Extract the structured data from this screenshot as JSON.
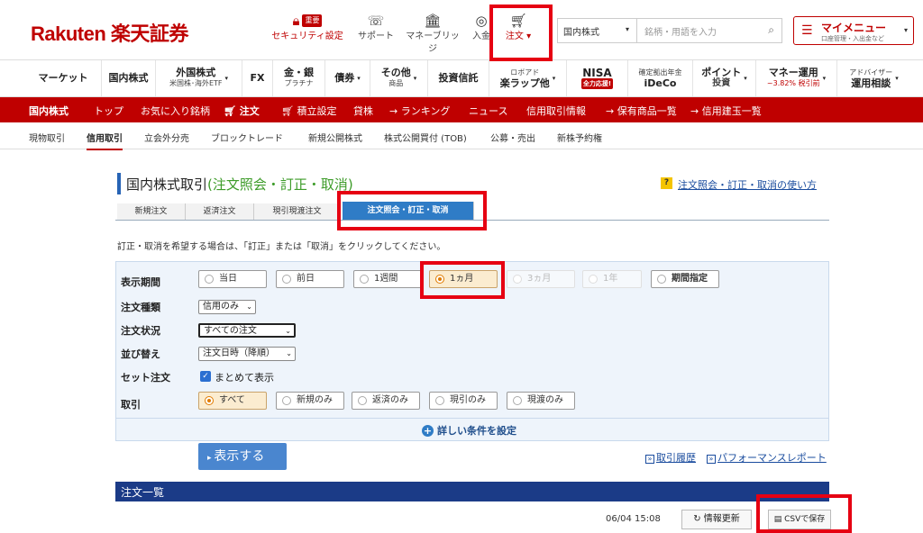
{
  "header": {
    "logo": "Rakuten 楽天証券",
    "security": {
      "label": "セキュリティ設定",
      "badge": "重要"
    },
    "support": "サポート",
    "bridge": "マネーブリッジ",
    "deposit": "入金",
    "order": "注文 ▾",
    "market_select": "国内株式",
    "search_placeholder": "銘柄・用語を入力",
    "mymenu_title": "マイメニュー",
    "mymenu_sub": "口座管理・入出金など"
  },
  "nav2": [
    {
      "label": "マーケット"
    },
    {
      "label": "国内株式"
    },
    {
      "label": "外国株式",
      "sub": "米国株･海外ETF"
    },
    {
      "label": "FX"
    },
    {
      "label": "金・銀",
      "sub": "プラチナ"
    },
    {
      "label": "債券"
    },
    {
      "label": "その他",
      "sub": "商品"
    },
    {
      "label": "投資信託"
    },
    {
      "label": "ロボアド",
      "sub": "楽ラップ他"
    },
    {
      "label": "NISA",
      "sub": "全力応援!"
    },
    {
      "label": "確定拠出年金",
      "sub": "iDeCo"
    },
    {
      "label": "ポイント",
      "sub": "投資"
    },
    {
      "label": "マネー運用",
      "sub": "~3.82% 税引前"
    },
    {
      "label": "アドバイザー",
      "sub": "運用相談"
    }
  ],
  "redbar": [
    "国内株式",
    "トップ",
    "お気に入り銘柄",
    "注文",
    "積立設定",
    "貸株",
    "→ ランキング",
    "ニュース",
    "信用取引情報",
    "→ 保有商品一覧",
    "→ 信用建玉一覧"
  ],
  "subtabs": [
    "現物取引",
    "信用取引",
    "立会外分売",
    "ブロックトレード",
    "新規公開株式",
    "株式公開買付 (TOB)",
    "公募・売出",
    "新株予約権"
  ],
  "page": {
    "title_main": "国内株式取引",
    "title_sub": "(注文照会・訂正・取消)",
    "help_link": "注文照会・訂正・取消の使い方",
    "help_icon": "?",
    "tabs": [
      "新規注文",
      "返済注文",
      "現引現渡注文",
      "注文照会・訂正・取消"
    ],
    "instruction": "訂正・取消を希望する場合は、「訂正」または「取消」をクリックしてください。"
  },
  "filters": {
    "period_label": "表示期間",
    "periods": [
      "当日",
      "前日",
      "1週間",
      "1ヵ月",
      "3ヵ月",
      "1年",
      "期間指定"
    ],
    "type_label": "注文種類",
    "type_value": "信用のみ",
    "status_label": "注文状況",
    "status_value": "すべての注文",
    "sort_label": "並び替え",
    "sort_value": "注文日時（降順）",
    "set_label": "セット注文",
    "set_check": "まとめて表示",
    "trade_label": "取引",
    "trades": [
      "すべて",
      "新規のみ",
      "返済のみ",
      "現引のみ",
      "現渡のみ"
    ],
    "more": "詳しい条件を設定",
    "show_button": "表示する",
    "history_link": "取引履歴",
    "report_link": "パフォーマンスレポート"
  },
  "list": {
    "title": "注文一覧",
    "timestamp": "06/04 15:08",
    "refresh": "情報更新",
    "csv": "CSVで保存"
  },
  "colors": {
    "brand": "#bf0000",
    "highlight": "#e60012",
    "navy": "#1b3b87"
  }
}
